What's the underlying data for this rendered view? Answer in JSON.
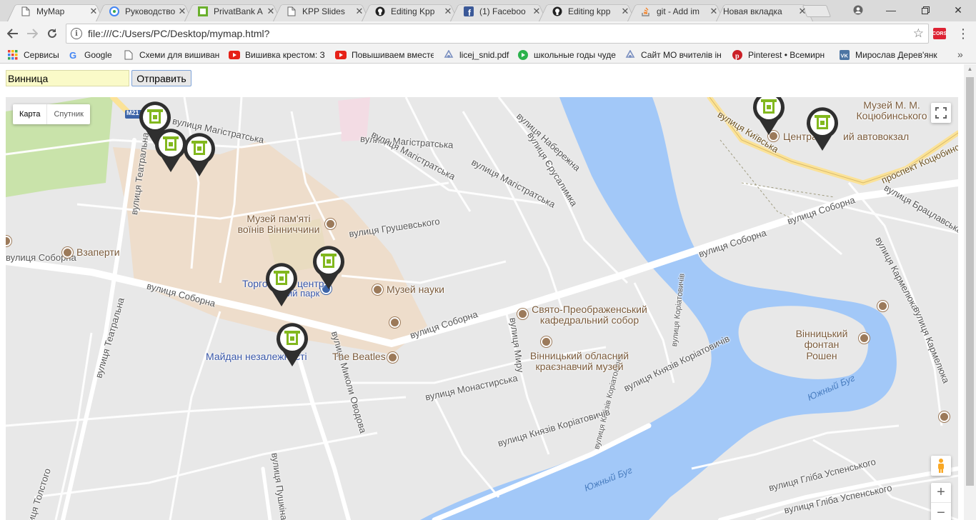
{
  "tabs": [
    {
      "title": "MyMap",
      "icon": "document-icon",
      "active": true
    },
    {
      "title": "Руководство",
      "icon": "google-maps-icon"
    },
    {
      "title": "PrivatBank A",
      "icon": "privatbank-icon"
    },
    {
      "title": "KPP Slides",
      "icon": "document-icon"
    },
    {
      "title": "Editing Kpp",
      "icon": "github-icon"
    },
    {
      "title": "(1) Faceboo",
      "icon": "facebook-icon"
    },
    {
      "title": "Editing kpp",
      "icon": "github-icon"
    },
    {
      "title": "git - Add im",
      "icon": "stackoverflow-icon"
    },
    {
      "title": "Новая вкладка",
      "icon": "none"
    }
  ],
  "toolbar": {
    "url": "file:///C:/Users/PC/Desktop/mymap.html?",
    "extension_label": "CORS"
  },
  "bookmarks": [
    {
      "label": "Сервисы",
      "icon": "apps-grid-icon"
    },
    {
      "label": "Google",
      "icon": "google-icon"
    },
    {
      "label": "Схеми для вишиван",
      "icon": "page-icon"
    },
    {
      "label": "Вишивка крестом: З",
      "icon": "youtube-icon"
    },
    {
      "label": "Повышиваем вместе",
      "icon": "youtube-icon"
    },
    {
      "label": "licej_snid.pdf",
      "icon": "drive-icon"
    },
    {
      "label": "школьные годы чуде",
      "icon": "play-icon"
    },
    {
      "label": "Сайт МО вчителів ін",
      "icon": "drive-icon"
    },
    {
      "label": "Pinterest • Всемирн",
      "icon": "pinterest-icon"
    },
    {
      "label": "Мирослав Дерев'янк",
      "icon": "vk-icon"
    }
  ],
  "form": {
    "city_value": "Винница",
    "submit_label": "Отправить"
  },
  "map": {
    "map_type_options": [
      "Карта",
      "Спутник"
    ],
    "selected_map_type": "Карта",
    "labels": {
      "road_m21": "M21",
      "magistratska_1": "вулиця Магістратська",
      "magistratska_2": "вулиця Магістратська",
      "magistratska_3": "вулиця Магістратська",
      "magistratska_4": "вулиця Магістратська",
      "naberezhna": "вулиця Набережна",
      "yerusalymka": "вулиця Єрусалимка",
      "teatralna_1": "вулиця Театральна",
      "teatralna_2": "вулиця Театральна",
      "hrushevskoho": "вулиця Грушевського",
      "sobornaya_1": "вулиця Соборна",
      "sobornaya_2": "вулиця Соборна",
      "sobornaya_3": "вулиця Соборна",
      "sobornaya_4": "вулиця Соборна",
      "sobornaya_5": "вулиця Соборна",
      "kyivska": "вулиця Київська",
      "kotsiubynskoho_ave": "проспект Коцюбинського",
      "bratslavska": "вулиця Брацлавська",
      "karmeliuka_1": "вулиця Кармелюка",
      "karmeliuka_2": "вулиця Кармелюка",
      "koriatovychiv_1": "вулиця Коріатовичів",
      "koriatovychiv_2": "вулиця Князів Коріатовичів",
      "koriatovychiv_3": "вулиця Князів Коріатовичів",
      "koriatovychiv_4": "вулиця Князів Коріатовичів",
      "monastyrska": "вулиця Монастирська",
      "myru": "вулиця Миру",
      "oderova": "вулиця Миколи Оводова",
      "pushkina": "вулиця Пушкіна",
      "tolstoho": "вулиця Толстого",
      "uspenskoho_1": "вулиця Гліба Успенського",
      "uspenskoho_2": "вулиця Гліба Успенського",
      "pivdennyi_buh_1": "Южный Буг",
      "pivdennyi_buh_2": "Южный Буг",
      "vzaperti": "Взаперти",
      "museum_memory": "Музей пам'яті воїнів Вінниччини",
      "tc_1": "Торгов",
      "tc_2": "центр",
      "tc_3": "ий парк",
      "science_museum": "Музей науки",
      "cathedral": "Свято-Преображенський кафедральний собор",
      "regional_museum": "Вінницький обласний краєзнавчий музей",
      "beatles": "The Beatles",
      "maidan": "Майдан незалежності",
      "fountain": "Вінницький фонтан Рошен",
      "kotsiubynskyi_museum": "Музей М. М. Коцюбинського",
      "bus_station_1": "Центра",
      "bus_station_2": "ий автовокзал"
    }
  },
  "colors": {
    "water": "#a2c8f8",
    "marker_green": "#82b81e",
    "marker_dark": "#2f2f2f",
    "park": "#c5e3a3",
    "highlight": "#f0dcc7"
  }
}
